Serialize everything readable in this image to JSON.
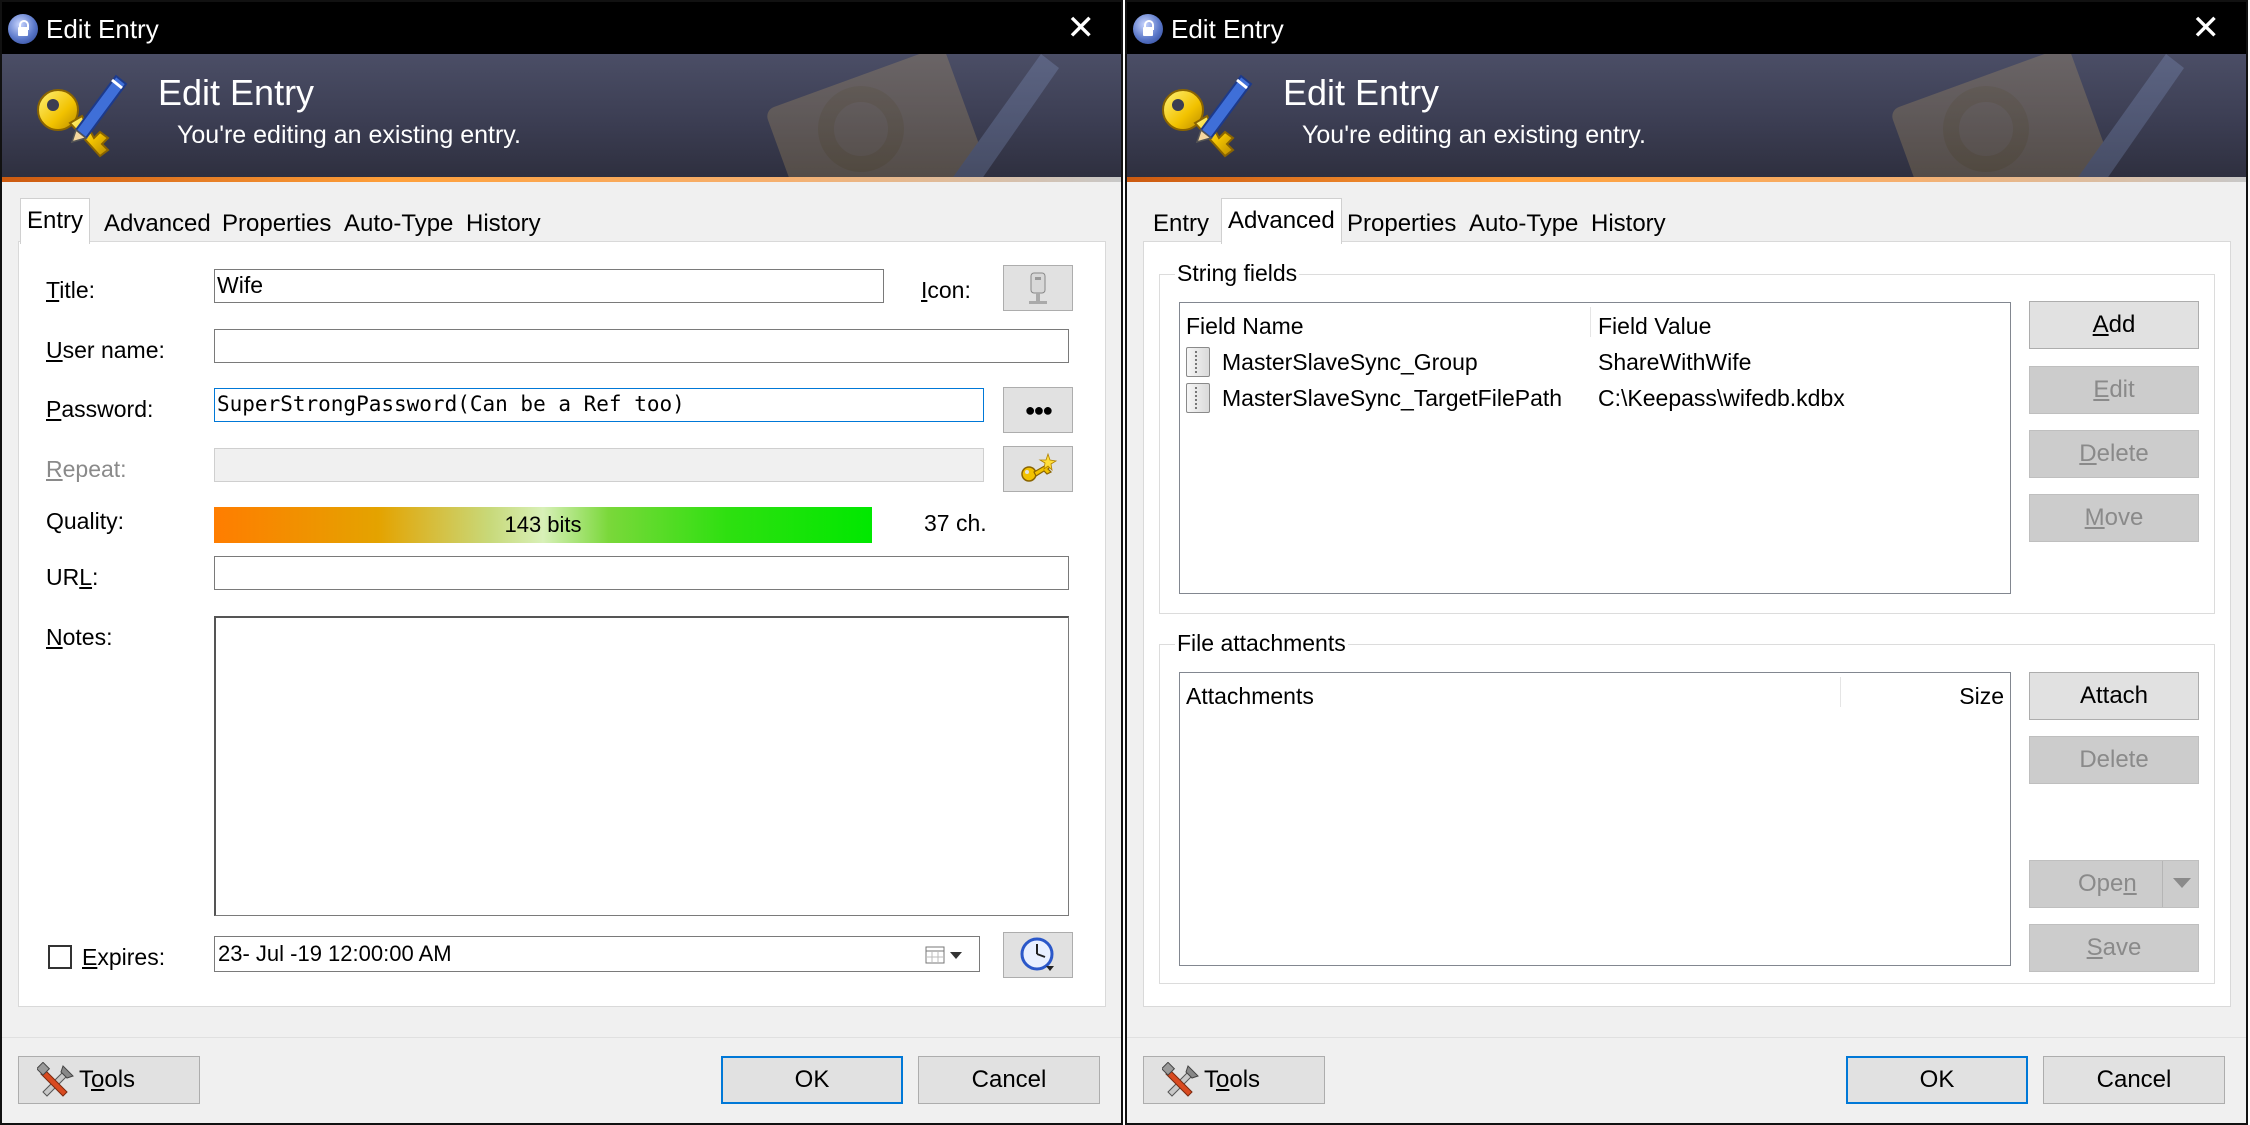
{
  "left": {
    "window_title": "Edit Entry",
    "close_glyph": "✕",
    "banner": {
      "title": "Edit Entry",
      "subtitle": "You're editing an existing entry."
    },
    "tabs": [
      "Entry",
      "Advanced",
      "Properties",
      "Auto-Type",
      "History"
    ],
    "active_tab": "Entry",
    "fields": {
      "title_label_pre": "",
      "title_label_u": "T",
      "title_label_post": "itle:",
      "title_value": "Wife",
      "icon_label_u": "I",
      "icon_label_post": "con:",
      "username_label_u": "U",
      "username_label_post": "ser name:",
      "username_value": "",
      "password_label_u": "P",
      "password_label_post": "assword:",
      "password_value": "SuperStrongPassword(Can be a Ref too)",
      "repeat_label_u": "R",
      "repeat_label_post": "epeat:",
      "repeat_value": "",
      "quality_label": "Quality:",
      "quality_text": "143 bits",
      "quality_fraction": 1.0,
      "char_count": "37 ch.",
      "url_label_pre": "UR",
      "url_label_u": "L",
      "url_label_post": ":",
      "url_value": "",
      "notes_label_u": "N",
      "notes_label_post": "otes:",
      "notes_value": "",
      "expires_label_u": "E",
      "expires_label_post": "xpires:",
      "expires_checked": false,
      "expires_value": "23- Jul -19 12:00:00 AM",
      "show_password_glyph": "●●●"
    },
    "footer": {
      "tools_pre": "T",
      "tools_u": "o",
      "tools_post": "ols",
      "ok": "OK",
      "cancel": "Cancel"
    }
  },
  "right": {
    "window_title": "Edit Entry",
    "close_glyph": "✕",
    "banner": {
      "title": "Edit Entry",
      "subtitle": "You're editing an existing entry."
    },
    "tabs": [
      "Entry",
      "Advanced",
      "Properties",
      "Auto-Type",
      "History"
    ],
    "active_tab": "Advanced",
    "string_fields": {
      "group_title": "String fields",
      "columns": [
        "Field Name",
        "Field Value"
      ],
      "rows": [
        {
          "name": "MasterSlaveSync_Group",
          "value": "ShareWithWife"
        },
        {
          "name": "MasterSlaveSync_TargetFilePath",
          "value": "C:\\Keepass\\wifedb.kdbx"
        }
      ],
      "buttons": {
        "add_u": "A",
        "add_post": "dd",
        "edit_u": "E",
        "edit_post": "dit",
        "delete_u": "D",
        "delete_post": "elete",
        "move_u": "M",
        "move_post": "ove"
      }
    },
    "attachments": {
      "group_title": "File attachments",
      "columns": [
        "Attachments",
        "Size"
      ],
      "buttons": {
        "attach": "Attach",
        "delete": "Delete",
        "open_pre": "Ope",
        "open_u": "n",
        "save_u": "S",
        "save_post": "ave"
      }
    },
    "footer": {
      "tools_pre": "T",
      "tools_u": "o",
      "tools_post": "ols",
      "ok": "OK",
      "cancel": "Cancel"
    }
  }
}
